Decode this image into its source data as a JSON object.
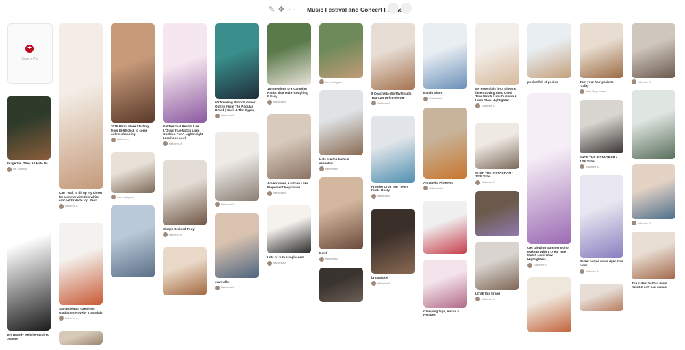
{
  "toolbar": {
    "board_title": "Music Festival and Concert Fashion",
    "edit_icon": "pencil-icon",
    "move_icon": "move-arrows-icon",
    "more_icon": "ellipsis-icon"
  },
  "save_pin": {
    "label": "Save a Pin",
    "icon": "plus-icon"
  },
  "columns": [
    [
      {
        "img_h": 93,
        "c1": "#2f3b2a",
        "c2": "#8a5d3b",
        "desc": "Image tile. They All Hate Us",
        "meta": "Kat · Ayeliah"
      },
      {
        "img_h": 218,
        "c1": "#ffffff",
        "c2": "#1b1b1b",
        "desc": "DIY Brandy Melville-Inspired Jeanne",
        "meta": ""
      }
    ],
    [
      {
        "img_h": 242,
        "c1": "#f3ede6",
        "c2": "#c59a7a",
        "desc": "Can't wait to fill up my closet for summer with this white crochet bralette top. Yes!",
        "meta": "Katherine A"
      },
      {
        "img_h": 120,
        "c1": "#f4f2ef",
        "c2": "#c85b36",
        "desc": "Sam Edelman Gretchen Gladiators Novelty T Sandals",
        "meta": "Katherine A"
      },
      {
        "img_h": 20,
        "c1": "#d6c9b8",
        "c2": "#9a8670",
        "desc": "",
        "meta": ""
      }
    ],
    [
      {
        "img_h": 145,
        "c1": "#c79a7a",
        "c2": "#5a3a2a",
        "desc": "2016 Bikini More Starting from $9.99 click to come online shopping!",
        "meta": "Katherine A"
      },
      {
        "img_h": 60,
        "c1": "#e9e1d8",
        "c2": "#7d6a58",
        "desc": "",
        "meta": "from Instagram"
      },
      {
        "img_h": 105,
        "c1": "#b9c9d8",
        "c2": "#5b6f86",
        "desc": "",
        "meta": ""
      }
    ],
    [
      {
        "img_h": 145,
        "c1": "#f6e6ef",
        "c2": "#8b5aa0",
        "desc": "Get Festival Ready! Use L'Oreal True Match Lumi Cushion For A Lightweight Luminous Look",
        "meta": "Katherine A"
      },
      {
        "img_h": 95,
        "c1": "#e4ddd5",
        "c2": "#6f5644",
        "desc": "Simple Braided Pony",
        "meta": "Katherine A"
      },
      {
        "img_h": 70,
        "c1": "#ead9c8",
        "c2": "#a2683f",
        "desc": "",
        "meta": ""
      }
    ],
    [
      {
        "img_h": 110,
        "c1": "#3a8f8c",
        "c2": "#1f2d3a",
        "desc": "60 Trending Boho Summer Outfits From The Popular Brand | Spell & The Gypsy",
        "meta": "Katherine A"
      },
      {
        "img_h": 100,
        "c1": "#efece8",
        "c2": "#8a7f75",
        "desc": "",
        "meta": "Katherine A"
      },
      {
        "img_h": 95,
        "c1": "#d9c3b0",
        "c2": "#4e647f",
        "desc": "coveralls",
        "meta": "Katherine A"
      }
    ],
    [
      {
        "img_h": 90,
        "c1": "#5a7a4a",
        "c2": "#e9e2d9",
        "desc": "18 Ingenious DIY Camping Hacks That Make Roughing It Easy",
        "meta": "Katherine A"
      },
      {
        "img_h": 95,
        "c1": "#d8cbbd",
        "c2": "#8a7263",
        "desc": "Adventurous Austrian Lake Elopement Inspiration",
        "meta": "Katherine A"
      },
      {
        "img_h": 70,
        "c1": "#f5f2ee",
        "c2": "#2a2a2a",
        "desc": "Lots of cute sunglasses!",
        "meta": "Katherine A"
      }
    ],
    [
      {
        "img_h": 80,
        "c1": "#6e8a5a",
        "c2": "#c29b76",
        "desc": "",
        "meta": "from Instagram"
      },
      {
        "img_h": 95,
        "c1": "#dfe3e6",
        "c2": "#8a6a52",
        "desc": "Hats are the festival essential",
        "meta": "Katherine A"
      },
      {
        "img_h": 105,
        "c1": "#d3b89f",
        "c2": "#6a4a3a",
        "desc": "Bowl",
        "meta": "Katherine A"
      },
      {
        "img_h": 50,
        "c1": "#3a3430",
        "c2": "#6d5f55",
        "desc": "",
        "meta": ""
      }
    ],
    [
      {
        "img_h": 97,
        "c1": "#e8ddd4",
        "c2": "#a57450",
        "desc": "8 Coachella-Worthy Braids You Can Definitely DIY",
        "meta": "Katherine A"
      },
      {
        "img_h": 98,
        "c1": "#e2e6ea",
        "c2": "#4f8fb0",
        "desc": "Frontier Crop Top | Jen's Pirate Booty",
        "meta": "Katherine A"
      },
      {
        "img_h": 95,
        "c1": "#3b2f2a",
        "c2": "#8a6a52",
        "desc": "brittanickel",
        "meta": "Katherine A"
      }
    ],
    [
      {
        "img_h": 96,
        "c1": "#e9eef3",
        "c2": "#6a8fb8",
        "desc": "Bandit Short",
        "meta": "Katherine A"
      },
      {
        "img_h": 104,
        "c1": "#c7b49a",
        "c2": "#c9762f",
        "desc": "Annabella Pinterest",
        "meta": "Katherine A"
      },
      {
        "img_h": 78,
        "c1": "#f0f0f0",
        "c2": "#c63c4a",
        "desc": "",
        "meta": ""
      },
      {
        "img_h": 70,
        "c1": "#f4e3ea",
        "c2": "#b26b87",
        "desc": "Glamping Tips, Hacks & Recipes",
        "meta": ""
      }
    ],
    [
      {
        "img_h": 90,
        "c1": "#f2eee9",
        "c2": "#d6b99c",
        "desc": "My essentials for a glowing face!! Loving the L'Oreal True Match Lumi Cushion & Lumi Glow Highlighter",
        "meta": "Katherine A"
      },
      {
        "img_h": 68,
        "c1": "#efe9e3",
        "c2": "#7b6a5a",
        "desc": "SHOP THE INSTAGRAM • 12th Tribe",
        "meta": "Katherine A"
      },
      {
        "img_h": 66,
        "c1": "#6b5a4b",
        "c2": "#8f7ab0",
        "desc": "",
        "meta": ""
      },
      {
        "img_h": 70,
        "c1": "#d9d4cf",
        "c2": "#7e6655",
        "desc": "LOVE this brand",
        "meta": "Katherine A"
      }
    ],
    [
      {
        "img_h": 80,
        "c1": "#e9eef2",
        "c2": "#c4a07c",
        "desc": "pocket full of posies",
        "meta": ""
      },
      {
        "img_h": 220,
        "c1": "#f6eef6",
        "c2": "#9b6bb3",
        "desc": "Get Glowing Summer Boho Makeup With L'Oreal True Match Lumi Glow Highlighters",
        "meta": "Katherine A"
      },
      {
        "img_h": 80,
        "c1": "#efe6dc",
        "c2": "#c2633a",
        "desc": "",
        "meta": ""
      }
    ],
    [
      {
        "img_h": 80,
        "c1": "#e8ddd0",
        "c2": "#9b6b44",
        "desc": "Turn your hair goals to reality",
        "meta": "Brian Mayo pinned"
      },
      {
        "img_h": 78,
        "c1": "#d9d6d2",
        "c2": "#3a3532",
        "desc": "SHOP THE INSTAGRAM • 12th Tribe",
        "meta": "Katherine A"
      },
      {
        "img_h": 120,
        "c1": "#e8e6f0",
        "c2": "#8a7fc0",
        "desc": "Pastel purple white dyed hair color",
        "meta": "Katherine A"
      },
      {
        "img_h": 40,
        "c1": "#e6ddd6",
        "c2": "#b87b5e",
        "desc": "",
        "meta": ""
      }
    ],
    [
      {
        "img_h": 80,
        "c1": "#cfc6bd",
        "c2": "#6b5a4f",
        "desc": "",
        "meta": "Katherine A"
      },
      {
        "img_h": 100,
        "c1": "#dfe6e1",
        "c2": "#5a6e5a",
        "desc": "",
        "meta": ""
      },
      {
        "img_h": 80,
        "c1": "#e4d2c5",
        "c2": "#4d6f8c",
        "desc": "",
        "meta": "Katherine A"
      },
      {
        "img_h": 70,
        "c1": "#e9ded3",
        "c2": "#a2674a",
        "desc": "The cutest fishtail braid detail & soft hair waves",
        "meta": ""
      }
    ]
  ]
}
